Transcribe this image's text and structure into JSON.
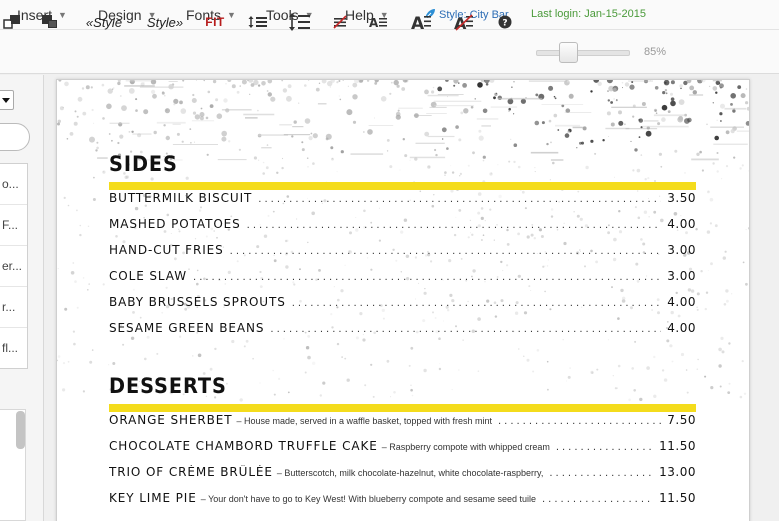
{
  "menubar": {
    "items": [
      {
        "label": "Insert"
      },
      {
        "label": "Design"
      },
      {
        "label": "Fonts"
      },
      {
        "label": "Tools"
      },
      {
        "label": "Help"
      }
    ],
    "style_label": "Style: City Bar",
    "last_login": "Last login: Jan-15-2015"
  },
  "toolbar": {
    "prev_style": "«Style",
    "next_style": "Style»",
    "fit_label": "FIT",
    "zoom": "85%",
    "zoom_fraction": 0.3
  },
  "left_panel": {
    "items": [
      "o...",
      "F...",
      "er...",
      "r...",
      "fl..."
    ]
  },
  "menu": {
    "sections": [
      {
        "title": "SIDES",
        "items": [
          {
            "name": "BUTTERMILK BISCUIT",
            "desc": "",
            "price": "3.50"
          },
          {
            "name": "MASHED POTATOES",
            "desc": "",
            "price": "4.00"
          },
          {
            "name": "HAND-CUT FRIES",
            "desc": "",
            "price": "3.00"
          },
          {
            "name": "COLE SLAW",
            "desc": "",
            "price": "3.00"
          },
          {
            "name": "BABY BRUSSELS SPROUTS",
            "desc": "",
            "price": "4.00"
          },
          {
            "name": "SESAME GREEN BEANS",
            "desc": "",
            "price": "4.00"
          }
        ]
      },
      {
        "title": "DESSERTS",
        "items": [
          {
            "name": "ORANGE SHERBET",
            "desc": "– House made, served in a waffle basket, topped with fresh mint",
            "price": "7.50"
          },
          {
            "name": "CHOCOLATE CHAMBORD TRUFFLE CAKE",
            "desc": "– Raspberry compote with whipped cream",
            "price": "11.50"
          },
          {
            "name": "TRIO OF CRÈME BRÛLÉE",
            "desc": "– Butterscotch, milk chocolate-hazelnut, white chocolate-raspberry,",
            "price": "13.00"
          },
          {
            "name": "KEY LIME PIE",
            "desc": "– Your don't have to go to Key West! With blueberry compote and sesame seed tuile",
            "price": "11.50"
          }
        ]
      }
    ]
  }
}
